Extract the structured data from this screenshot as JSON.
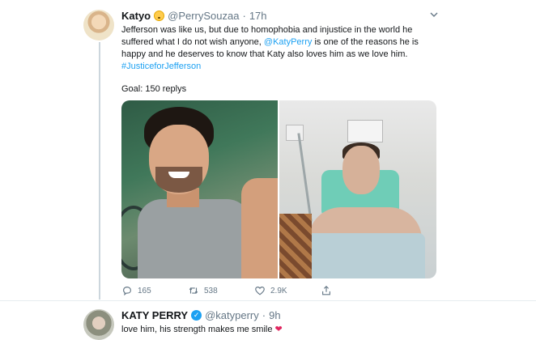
{
  "tweet1": {
    "display_name": "Katyo",
    "emoji_icon": "hushed-face-emoji",
    "handle": "@PerrySouzaa",
    "dot": "·",
    "time": "17h",
    "text_part1": "Jefferson was like us, but due to homophobia and injustice in the world he suffered what I do not wish anyone, ",
    "mention": "@KatyPerry",
    "text_part2": " is one of the reasons he is happy and he deserves to know that Katy also loves him as we love him.",
    "hashtag": "#JusticeforJefferson",
    "goal": "Goal: 150 replys",
    "reply_count": "165",
    "retweet_count": "538",
    "like_count": "2.9K"
  },
  "tweet2": {
    "display_name": "KATY PERRY",
    "verified_icon": "verified-badge-icon",
    "handle": "@katyperry",
    "dot": "·",
    "time": "9h",
    "text": "love him, his strength makes me smile",
    "heart": "❤"
  },
  "icons": {
    "reply": "reply-icon",
    "retweet": "retweet-icon",
    "like": "like-icon",
    "share": "share-icon",
    "caret": "chevron-down-icon"
  },
  "colors": {
    "link": "#1da1f2",
    "secondary_text": "#657786",
    "heart": "#e0245e"
  }
}
